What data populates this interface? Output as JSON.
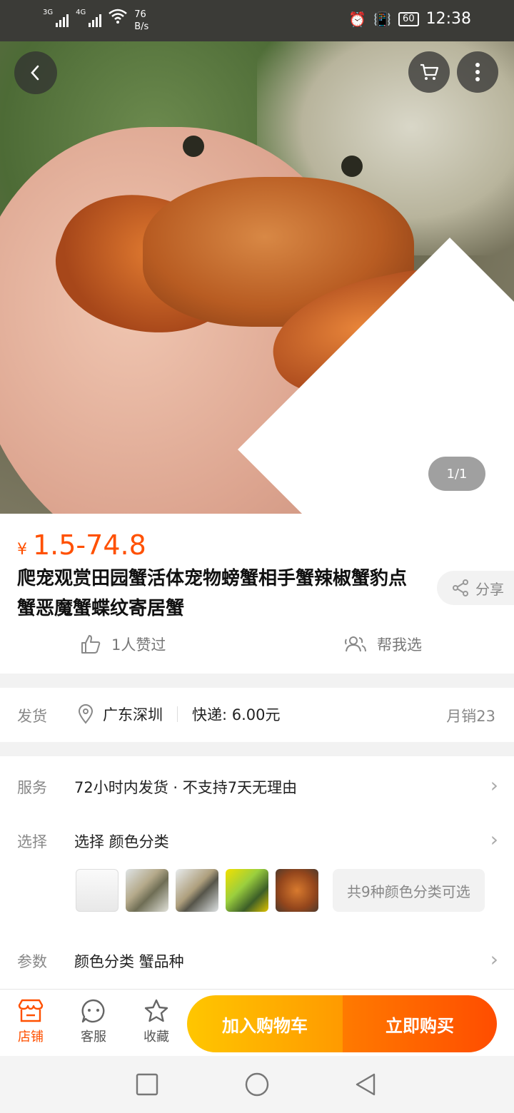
{
  "status_bar": {
    "signal1": "3G",
    "signal2": "4G",
    "speed_value": "76",
    "speed_unit": "B/s",
    "battery": "60",
    "time": "12:38"
  },
  "gallery": {
    "counter": "1/1"
  },
  "product": {
    "currency": "¥",
    "price": "1.5-74.8",
    "title": "爬宠观赏田园蟹活体宠物螃蟹相手蟹辣椒蟹豹点蟹恶魔蟹蝶纹寄居蟹",
    "share_label": "分享",
    "likes_label": "1人赞过",
    "help_label": "帮我选"
  },
  "shipping": {
    "label": "发货",
    "location": "广东深圳",
    "express": "快递: 6.00元",
    "monthly_sales": "月销23"
  },
  "service": {
    "label": "服务",
    "value": "72小时内发货 · 不支持7天无理由"
  },
  "select": {
    "label": "选择",
    "value": "选择 颜色分类",
    "more_colors": "共9种颜色分类可选"
  },
  "params": {
    "label": "参数",
    "value": "颜色分类 蟹品种"
  },
  "action_bar": {
    "shop": "店铺",
    "service": "客服",
    "favorite": "收藏",
    "add_to_cart": "加入购物车",
    "buy_now": "立即购买"
  },
  "colors": {
    "accent": "#ff5000",
    "cart_button": "#ffb000",
    "buy_button": "#ff5a00"
  },
  "icons": [
    "back-icon",
    "cart-icon",
    "more-icon",
    "share-icon",
    "thumb-up-icon",
    "people-icon",
    "location-icon",
    "chevron-right-icon",
    "store-icon",
    "chat-icon",
    "star-icon"
  ]
}
